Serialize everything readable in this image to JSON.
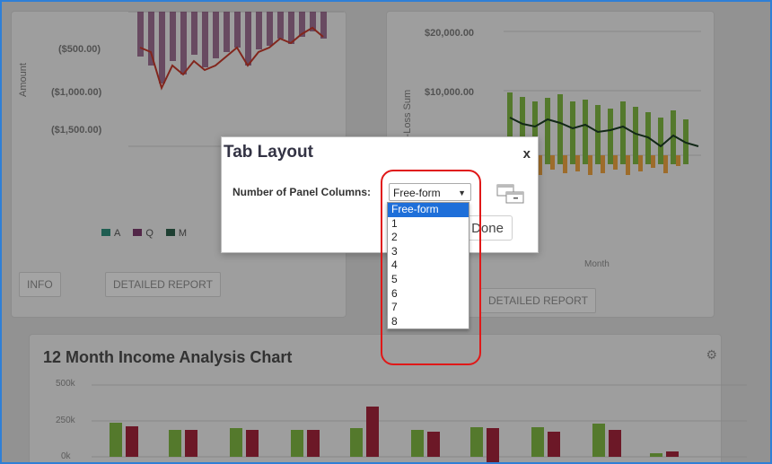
{
  "background": {
    "left_chart": {
      "y_ticks": [
        "($500.00)",
        "($1,000.00)",
        "($1,500.00)"
      ],
      "y_label": "Amount",
      "legend": [
        "A",
        "Q",
        "M"
      ],
      "buttons": [
        "INFO",
        "DETAILED REPORT"
      ]
    },
    "right_chart": {
      "y_ticks": [
        "$20,000.00",
        "$10,000.00"
      ],
      "y_label": "Profit-Loss Sum",
      "x_label": "Month",
      "buttons": [
        "DETAILED REPORT"
      ]
    },
    "bottom_chart": {
      "title": "12 Month Income Analysis Chart",
      "y_ticks": [
        "500k",
        "250k",
        "0k"
      ]
    }
  },
  "modal": {
    "title": "Tab Layout",
    "close_label": "x",
    "field_label": "Number of Panel Columns:",
    "selected_value": "Free-form",
    "done_label": "Done",
    "icon": "layout-icon"
  },
  "dropdown": {
    "options": [
      "Free-form",
      "1",
      "2",
      "3",
      "4",
      "5",
      "6",
      "7",
      "8"
    ],
    "highlighted_index": 0
  },
  "colors": {
    "highlight_ring": "#e01818",
    "selection_blue": "#1e6fd9",
    "frame_blue": "#2f7fd6"
  }
}
